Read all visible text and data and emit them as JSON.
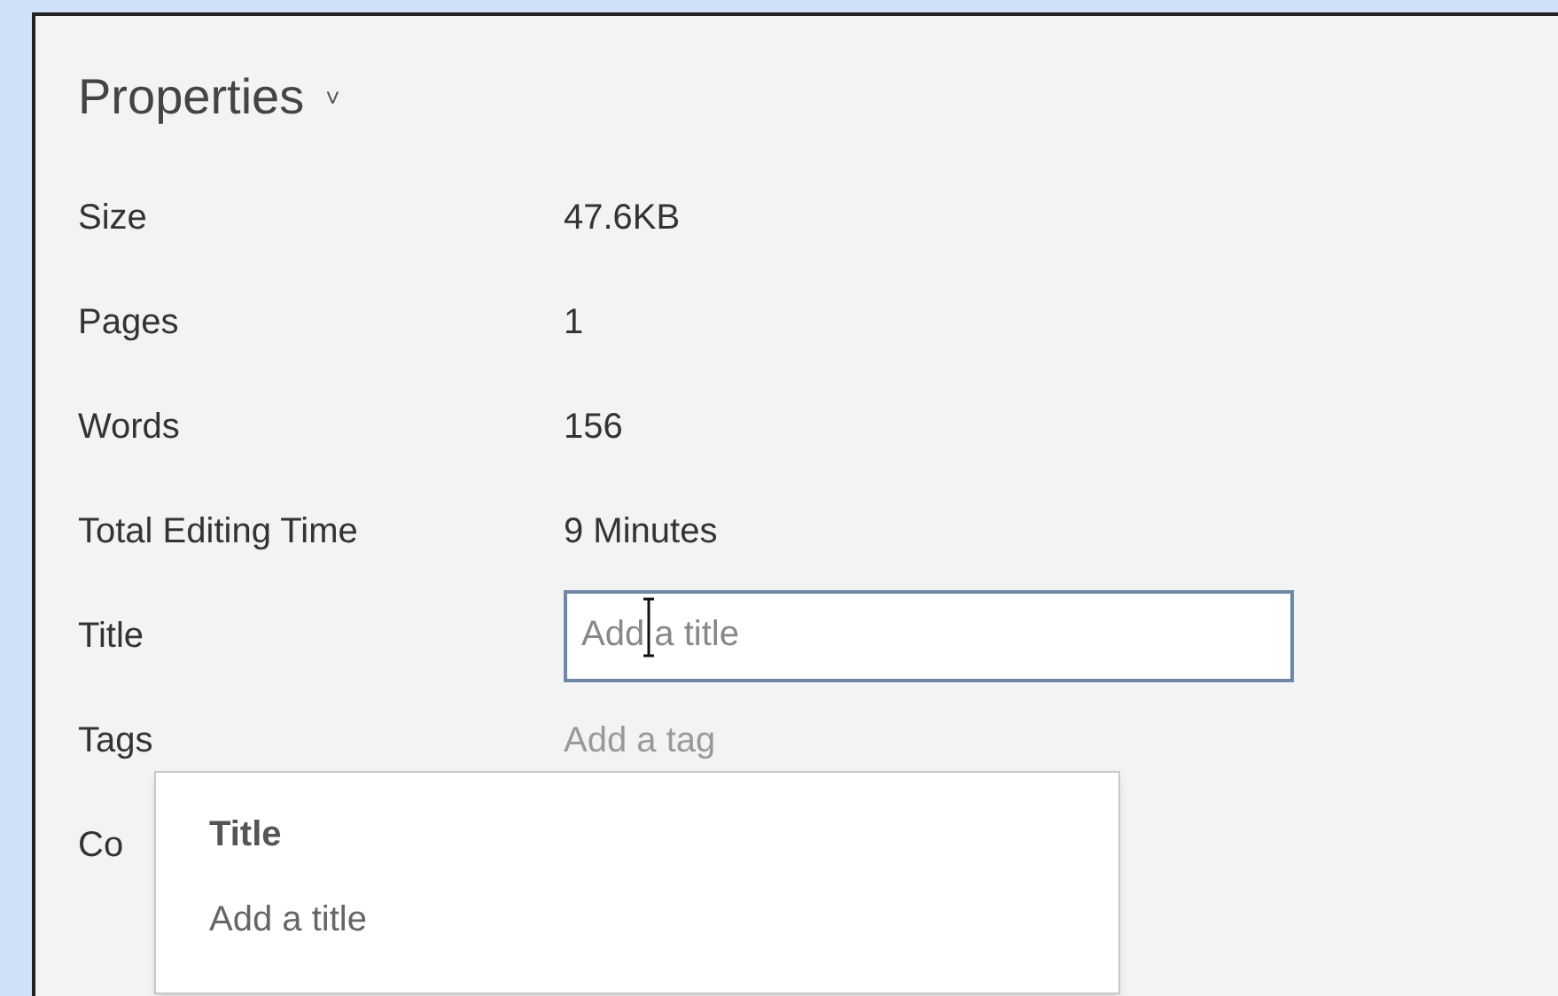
{
  "panel": {
    "heading": "Properties",
    "heading_caret": "˅",
    "rows": [
      {
        "kind": "text",
        "label": "Size",
        "value": "47.6KB"
      },
      {
        "kind": "text",
        "label": "Pages",
        "value": "1"
      },
      {
        "kind": "text",
        "label": "Words",
        "value": "156"
      },
      {
        "kind": "text",
        "label": "Total Editing Time",
        "value": "9 Minutes"
      },
      {
        "kind": "field",
        "label": "Title",
        "placeholder": "Add a title",
        "focused": true
      },
      {
        "kind": "hint",
        "label": "Tags",
        "value": "Add a tag"
      },
      {
        "kind": "text",
        "label": "Co"
      }
    ]
  },
  "tooltip": {
    "title": "Title",
    "text": "Add a title"
  }
}
